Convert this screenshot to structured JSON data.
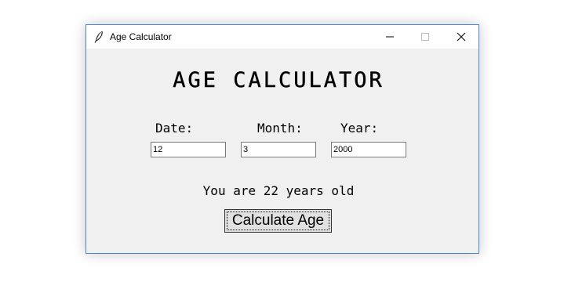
{
  "window": {
    "title": "Age Calculator",
    "icon": "feather-icon",
    "controls": [
      "minimize-icon",
      "maximize-icon",
      "close-icon"
    ]
  },
  "main": {
    "heading": "AGE CALCULATOR",
    "labels": {
      "date": "Date:",
      "month": "Month:",
      "year": "Year:"
    },
    "inputs": {
      "date": "12",
      "month": "3",
      "year": "2000"
    },
    "result": "You are 22 years old",
    "calculate_label": "Calculate Age"
  },
  "colors": {
    "window_border": "#4a86c7",
    "client_background": "#f0f0f0",
    "button_background": "#e1e1e1"
  }
}
